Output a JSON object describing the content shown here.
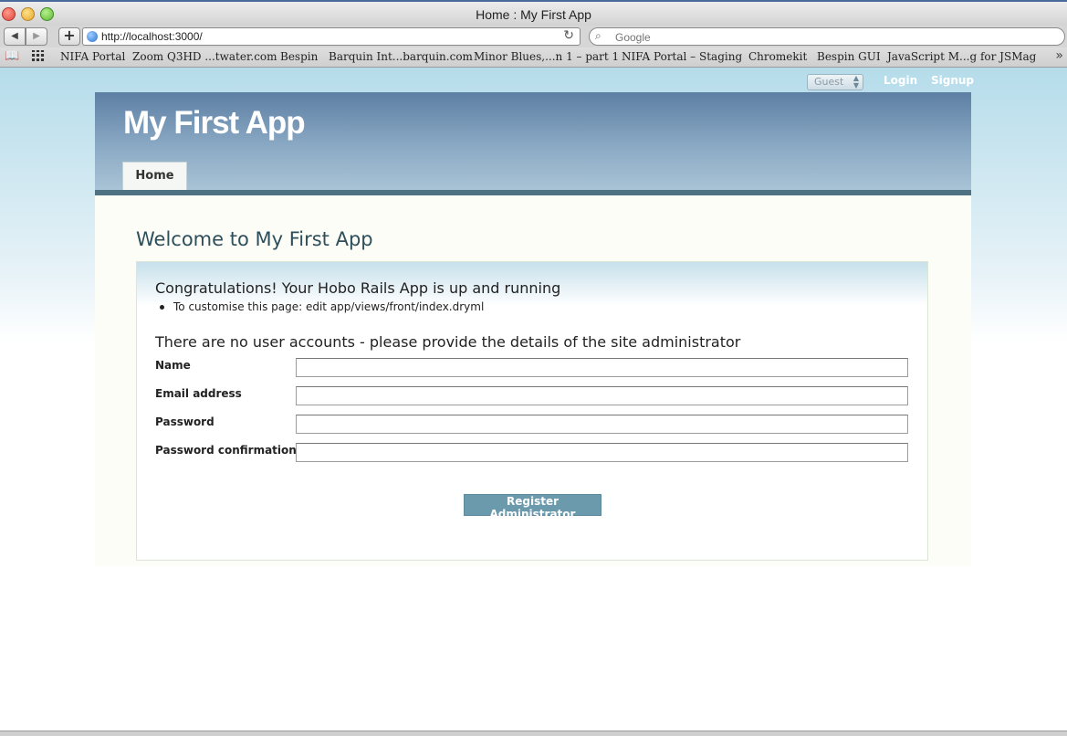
{
  "window": {
    "title": "Home : My First App"
  },
  "toolbar": {
    "back_icon": "◀",
    "forward_icon": "▶",
    "add_icon": "+",
    "url": "http://localhost:3000/",
    "reload_icon": "↻",
    "search_placeholder": "Google",
    "search_icon": "⌕"
  },
  "bookmarks": {
    "items": [
      "NIFA Portal",
      "Zoom Q3HD ...twater.com",
      "Bespin",
      "Barquin Int...barquin.com",
      "Minor Blues,...n 1 – part 1",
      "NIFA Portal –  Staging",
      "Chromekit",
      "Bespin GUI",
      "JavaScript M...g for JSMag"
    ],
    "more_icon": "»"
  },
  "account_nav": {
    "role_select": "Guest",
    "login": "Login",
    "signup": "Signup"
  },
  "header": {
    "app_name": "My First App",
    "tabs": [
      {
        "label": "Home",
        "active": true
      }
    ]
  },
  "main": {
    "heading": "Welcome to My First App",
    "card": {
      "title": "Congratulations! Your Hobo Rails App is up and running",
      "bullet": "To customise this page: edit app/views/front/index.dryml",
      "section_title": "There are no user accounts - please provide the details of the site administrator",
      "fields": [
        {
          "label": "Name",
          "value": ""
        },
        {
          "label": "Email address",
          "value": ""
        },
        {
          "label": "Password",
          "value": ""
        },
        {
          "label": "Password confirmation",
          "value": ""
        }
      ],
      "submit_label": "Register Administrator"
    }
  },
  "colors": {
    "header_top": "#5d7fa3",
    "header_rule": "#4f7282",
    "button": "#6c9aad",
    "heading_text": "#2d4f5c"
  }
}
